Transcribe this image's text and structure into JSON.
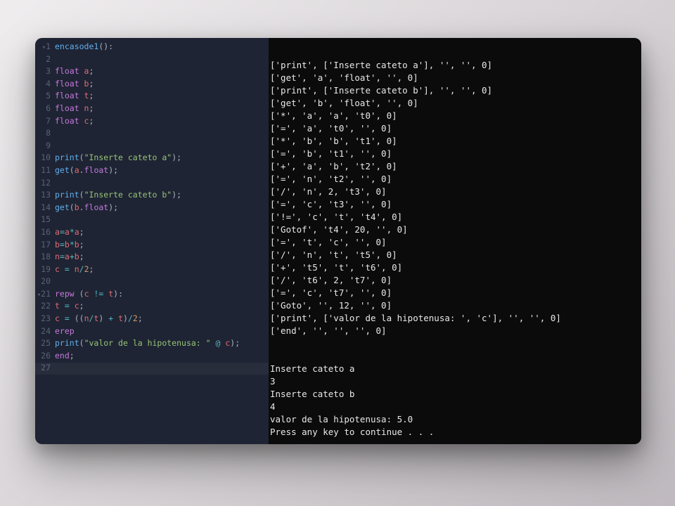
{
  "editor": {
    "lines": [
      {
        "n": 1,
        "fold": true,
        "tokens": [
          [
            "fn",
            "encasode1"
          ],
          [
            "punct",
            "():"
          ]
        ]
      },
      {
        "n": 2,
        "tokens": []
      },
      {
        "n": 3,
        "tokens": [
          [
            "type",
            "float "
          ],
          [
            "id",
            "a"
          ],
          [
            "punct",
            ";"
          ]
        ]
      },
      {
        "n": 4,
        "tokens": [
          [
            "type",
            "float "
          ],
          [
            "id",
            "b"
          ],
          [
            "punct",
            ";"
          ]
        ]
      },
      {
        "n": 5,
        "tokens": [
          [
            "type",
            "float "
          ],
          [
            "id",
            "t"
          ],
          [
            "punct",
            ";"
          ]
        ]
      },
      {
        "n": 6,
        "tokens": [
          [
            "type",
            "float "
          ],
          [
            "id",
            "n"
          ],
          [
            "punct",
            ";"
          ]
        ]
      },
      {
        "n": 7,
        "tokens": [
          [
            "type",
            "float "
          ],
          [
            "id",
            "c"
          ],
          [
            "punct",
            ";"
          ]
        ]
      },
      {
        "n": 8,
        "tokens": []
      },
      {
        "n": 9,
        "tokens": []
      },
      {
        "n": 10,
        "tokens": [
          [
            "fn",
            "print"
          ],
          [
            "punct",
            "("
          ],
          [
            "str",
            "\"Inserte cateto a\""
          ],
          [
            "punct",
            ");"
          ]
        ]
      },
      {
        "n": 11,
        "tokens": [
          [
            "fn",
            "get"
          ],
          [
            "punct",
            "("
          ],
          [
            "id",
            "a"
          ],
          [
            "punct",
            "."
          ],
          [
            "type",
            "float"
          ],
          [
            "punct",
            ");"
          ]
        ]
      },
      {
        "n": 12,
        "tokens": []
      },
      {
        "n": 13,
        "tokens": [
          [
            "fn",
            "print"
          ],
          [
            "punct",
            "("
          ],
          [
            "str",
            "\"Inserte cateto b\""
          ],
          [
            "punct",
            ");"
          ]
        ]
      },
      {
        "n": 14,
        "tokens": [
          [
            "fn",
            "get"
          ],
          [
            "punct",
            "("
          ],
          [
            "id",
            "b"
          ],
          [
            "punct",
            "."
          ],
          [
            "type",
            "float"
          ],
          [
            "punct",
            ");"
          ]
        ]
      },
      {
        "n": 15,
        "tokens": []
      },
      {
        "n": 16,
        "tokens": [
          [
            "id",
            "a"
          ],
          [
            "op",
            "="
          ],
          [
            "id",
            "a"
          ],
          [
            "op",
            "*"
          ],
          [
            "id",
            "a"
          ],
          [
            "punct",
            ";"
          ]
        ]
      },
      {
        "n": 17,
        "tokens": [
          [
            "id",
            "b"
          ],
          [
            "op",
            "="
          ],
          [
            "id",
            "b"
          ],
          [
            "op",
            "*"
          ],
          [
            "id",
            "b"
          ],
          [
            "punct",
            ";"
          ]
        ]
      },
      {
        "n": 18,
        "tokens": [
          [
            "id",
            "n"
          ],
          [
            "op",
            "="
          ],
          [
            "id",
            "a"
          ],
          [
            "op",
            "+"
          ],
          [
            "id",
            "b"
          ],
          [
            "punct",
            ";"
          ]
        ]
      },
      {
        "n": 19,
        "tokens": [
          [
            "id",
            "c"
          ],
          [
            "op",
            " = "
          ],
          [
            "id",
            "n"
          ],
          [
            "op",
            "/"
          ],
          [
            "num",
            "2"
          ],
          [
            "punct",
            ";"
          ]
        ]
      },
      {
        "n": 20,
        "tokens": []
      },
      {
        "n": 21,
        "fold": true,
        "tokens": [
          [
            "kw",
            "repw"
          ],
          [
            "punct",
            " ("
          ],
          [
            "id",
            "c"
          ],
          [
            "op",
            " != "
          ],
          [
            "id",
            "t"
          ],
          [
            "punct",
            "):"
          ]
        ]
      },
      {
        "n": 22,
        "tokens": [
          [
            "id",
            "t"
          ],
          [
            "op",
            " = "
          ],
          [
            "id",
            "c"
          ],
          [
            "punct",
            ";"
          ]
        ]
      },
      {
        "n": 23,
        "tokens": [
          [
            "id",
            "c"
          ],
          [
            "op",
            " = "
          ],
          [
            "punct",
            "(("
          ],
          [
            "id",
            "n"
          ],
          [
            "op",
            "/"
          ],
          [
            "id",
            "t"
          ],
          [
            "punct",
            ")"
          ],
          [
            "op",
            " + "
          ],
          [
            "id",
            "t"
          ],
          [
            "punct",
            ")"
          ],
          [
            "op",
            "/"
          ],
          [
            "num",
            "2"
          ],
          [
            "punct",
            ";"
          ]
        ]
      },
      {
        "n": 24,
        "tokens": [
          [
            "kw",
            "erep"
          ]
        ]
      },
      {
        "n": 25,
        "tokens": [
          [
            "fn",
            "print"
          ],
          [
            "punct",
            "("
          ],
          [
            "str",
            "\"valor de la hipotenusa: \""
          ],
          [
            "op",
            " @ "
          ],
          [
            "id",
            "c"
          ],
          [
            "punct",
            ");"
          ]
        ]
      },
      {
        "n": 26,
        "tokens": [
          [
            "kw",
            "end"
          ],
          [
            "punct",
            ";"
          ]
        ]
      },
      {
        "n": 27,
        "cursor": true,
        "tokens": []
      }
    ]
  },
  "output_lines": [
    "['print', ['Inserte cateto a'], '', '', 0]",
    "['get', 'a', 'float', '', 0]",
    "['print', ['Inserte cateto b'], '', '', 0]",
    "['get', 'b', 'float', '', 0]",
    "['*', 'a', 'a', 't0', 0]",
    "['=', 'a', 't0', '', 0]",
    "['*', 'b', 'b', 't1', 0]",
    "['=', 'b', 't1', '', 0]",
    "['+', 'a', 'b', 't2', 0]",
    "['=', 'n', 't2', '', 0]",
    "['/', 'n', 2, 't3', 0]",
    "['=', 'c', 't3', '', 0]",
    "['!=', 'c', 't', 't4', 0]",
    "['Gotof', 't4', 20, '', 0]",
    "['=', 't', 'c', '', 0]",
    "['/', 'n', 't', 't5', 0]",
    "['+', 't5', 't', 't6', 0]",
    "['/', 't6', 2, 't7', 0]",
    "['=', 'c', 't7', '', 0]",
    "['Goto', '', 12, '', 0]",
    "['print', ['valor de la hipotenusa: ', 'c'], '', '', 0]",
    "['end', '', '', '', 0]",
    "",
    "",
    "Inserte cateto a",
    "3",
    "Inserte cateto b",
    "4",
    "valor de la hipotenusa: 5.0",
    "Press any key to continue . . ."
  ]
}
